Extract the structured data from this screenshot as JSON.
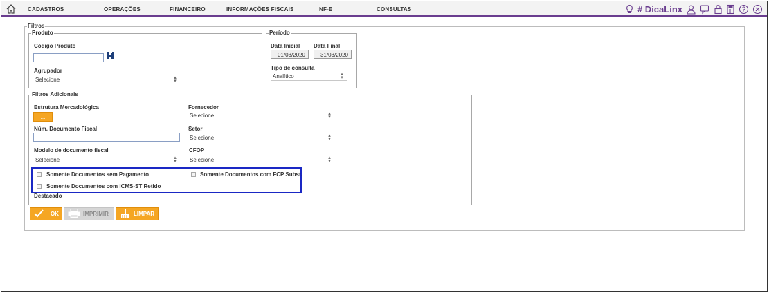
{
  "nav": {
    "items": [
      "CADASTROS",
      "OPERAÇÕES",
      "FINANCEIRO",
      "INFORMAÇÕES FISCAIS",
      "NF-E",
      "CONSULTAS"
    ],
    "dica_label": "# DicaLinx",
    "accent_color": "#6a3d8f"
  },
  "filtros": {
    "legend": "Filtros",
    "produto": {
      "legend": "Produto",
      "codigo_label": "Código Produto",
      "codigo_value": "",
      "agrupador_label": "Agrupador",
      "agrupador_value": "Selecione"
    },
    "periodo": {
      "legend": "Período",
      "data_inicial_label": "Data Inicial",
      "data_inicial_value": "01/03/2020",
      "data_final_label": "Data Final",
      "data_final_value": "31/03/2020",
      "tipo_label": "Tipo de consulta",
      "tipo_value": "Analítico"
    },
    "adicionais": {
      "legend": "Filtros Adicionais",
      "estrutura_label": "Estrutura Mercadológica",
      "estrutura_button": "...",
      "fornecedor_label": "Fornecedor",
      "fornecedor_value": "Selecione",
      "num_doc_label": "Núm. Documento Fiscal",
      "num_doc_value": "",
      "setor_label": "Setor",
      "setor_value": "Selecione",
      "modelo_label": "Modelo de documento fiscal",
      "modelo_value": "Selecione",
      "cfop_label": "CFOP",
      "cfop_value": "Selecione",
      "chk_sem_pagamento": "Somente Documentos sem Pagamento",
      "chk_fcp": "Somente Documentos com FCP Subst.",
      "chk_icms": "Somente Documentos com ICMS-ST Retido",
      "chk_icms_cont": "Destacado"
    }
  },
  "actions": {
    "ok": "OK",
    "imprimir": "IMPRIMIR",
    "limpar": "LIMPAR"
  },
  "colors": {
    "orange": "#f5a623",
    "highlight_border": "#1a28c4"
  }
}
